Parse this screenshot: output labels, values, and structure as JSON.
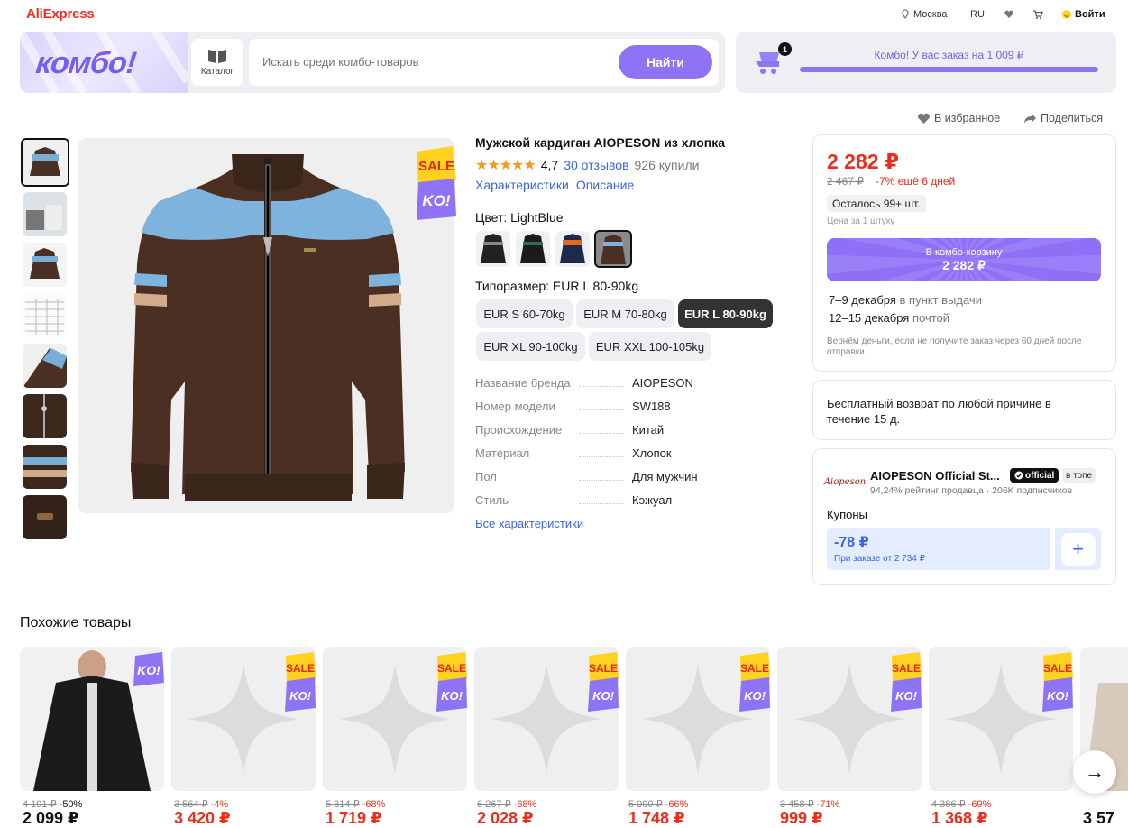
{
  "header": {
    "logo": "AliExpress",
    "location": "Москва",
    "language": "RU",
    "login": "Войти"
  },
  "combo": {
    "banner_text": "комбо!",
    "catalog_label": "Каталог",
    "search_placeholder": "Искать среди комбо-товаров",
    "search_button": "Найти",
    "cart_count": "1",
    "cart_message": "Комбо! У вас заказ на 1 009 ₽"
  },
  "actions": {
    "favorite": "В избранное",
    "share": "Поделиться"
  },
  "product": {
    "title": "Мужской кардиган AIOPESON из хлопка",
    "rating": "4,7",
    "reviews": "30 отзывов",
    "bought": "926 купили",
    "tab_specs": "Характеристики",
    "tab_description": "Описание",
    "color_label": "Цвет: LightBlue",
    "size_label": "Типоразмер: EUR L 80-90kg",
    "sizes": [
      "EUR S 60-70kg",
      "EUR M 70-80kg",
      "EUR L 80-90kg",
      "EUR XL 90-100kg",
      "EUR XXL 100-105kg"
    ],
    "selected_size": "EUR L 80-90kg",
    "specs": [
      {
        "k": "Название бренда",
        "v": "AIOPESON"
      },
      {
        "k": "Номер модели",
        "v": "SW188"
      },
      {
        "k": "Происхождение",
        "v": "Китай"
      },
      {
        "k": "Материал",
        "v": "Хлопок"
      },
      {
        "k": "Пол",
        "v": "Для мужчин"
      },
      {
        "k": "Стиль",
        "v": "Кэжуал"
      }
    ],
    "all_specs": "Все характеристики",
    "sale_badge": "SALE",
    "ko_badge": "KO!"
  },
  "price_card": {
    "price": "2 282 ₽",
    "old_price": "2 467 ₽",
    "discount": "-7% ещё 6 дней",
    "stock": "Осталось 99+ шт.",
    "unit": "Цена за 1 штуку",
    "combo_btn_l1": "В комбо-корзину",
    "combo_btn_l2": "2 282 ₽",
    "delivery1_date": "7–9 декабря",
    "delivery1_method": "в пункт выдачи",
    "delivery2_date": "12–15 декабря",
    "delivery2_method": "почтой",
    "refund": "Вернём деньги, если не получите заказ через 60 дней после отправки."
  },
  "return_card": {
    "text": "Бесплатный возврат по любой причине в течение 15 д."
  },
  "seller": {
    "logo_text": "Aiopeson",
    "name": "AIOPESON Official St...",
    "official": "official",
    "top": "в топе",
    "sub": "94,24% рейтинг продавца · 206K подписчиков",
    "coupons_label": "Купоны",
    "coupon_value": "-78 ₽",
    "coupon_condition": "При заказе от 2 734 ₽"
  },
  "similar": {
    "title": "Похожие товары",
    "items": [
      {
        "old": "4 191 ₽",
        "disc": "-50%",
        "price": "2 099 ₽"
      },
      {
        "old": "3 564 ₽",
        "disc": "-4%",
        "price": "3 420 ₽"
      },
      {
        "old": "5 314 ₽",
        "disc": "-68%",
        "price": "1 719 ₽"
      },
      {
        "old": "6 267 ₽",
        "disc": "-68%",
        "price": "2 028 ₽"
      },
      {
        "old": "5 090 ₽",
        "disc": "-66%",
        "price": "1 748 ₽"
      },
      {
        "old": "3 458 ₽",
        "disc": "-71%",
        "price": "999 ₽"
      },
      {
        "old": "4 386 ₽",
        "disc": "-69%",
        "price": "1 368 ₽"
      },
      {
        "old": "",
        "disc": "",
        "price": "3 57"
      }
    ]
  },
  "colors": {
    "accent": "#8f73f5",
    "price_red": "#ee2c1b",
    "link_blue": "#3a63e6"
  }
}
